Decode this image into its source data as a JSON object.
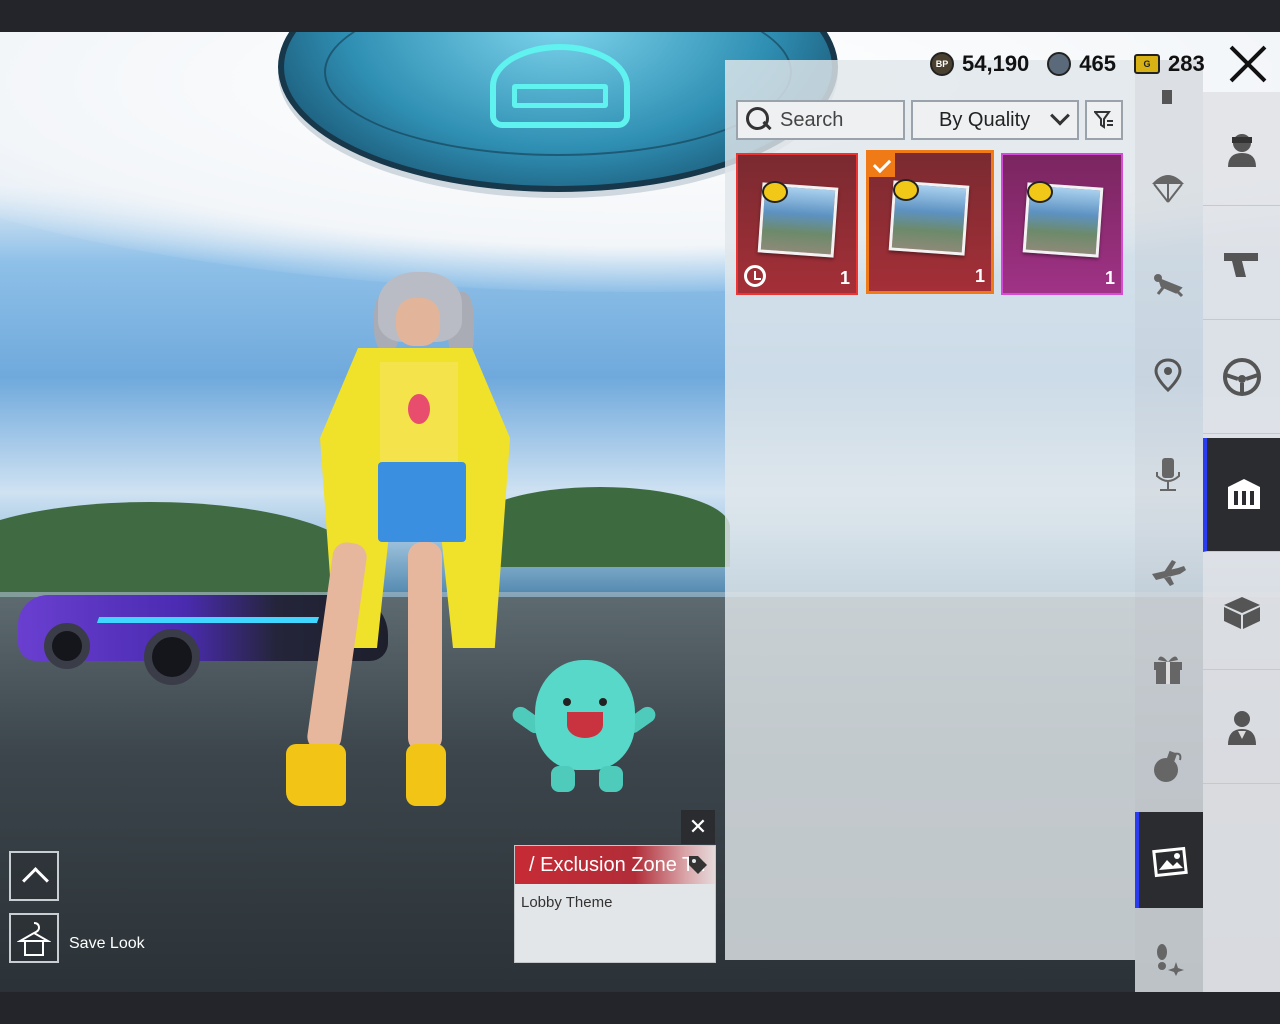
{
  "currencies": [
    {
      "icon": "bp-coin-icon",
      "label": "BP",
      "value": "54,190"
    },
    {
      "icon": "silver-coin-icon",
      "value": "465"
    },
    {
      "icon": "g-coin-icon",
      "label": "G",
      "value": "283"
    }
  ],
  "search": {
    "placeholder": "Search",
    "value": ""
  },
  "sort": {
    "selected": "By Quality"
  },
  "items": [
    {
      "quantity": "1",
      "quality_color": "#e33333",
      "timed": true,
      "selected": false
    },
    {
      "quantity": "1",
      "quality_color": "#f07a16",
      "timed": false,
      "selected": true
    },
    {
      "quantity": "1",
      "quality_color": "#d34bd6",
      "timed": false,
      "selected": false
    }
  ],
  "sub_categories": [
    "pin-icon",
    "parachute-icon",
    "skydive-emote-icon",
    "map-marker-icon",
    "microphone-icon",
    "airplane-icon",
    "gift-icon",
    "grenade-icon",
    "lobby-theme-icon",
    "footprint-icon"
  ],
  "main_categories": [
    "character-icon",
    "pistol-icon",
    "steering-wheel-icon",
    "lobby-icon",
    "crate-icon",
    "avatar-icon"
  ],
  "tooltip": {
    "title": "/ Exclusion Zone Th",
    "subtitle": "Lobby Theme"
  },
  "save_look": {
    "label": "Save Look"
  }
}
